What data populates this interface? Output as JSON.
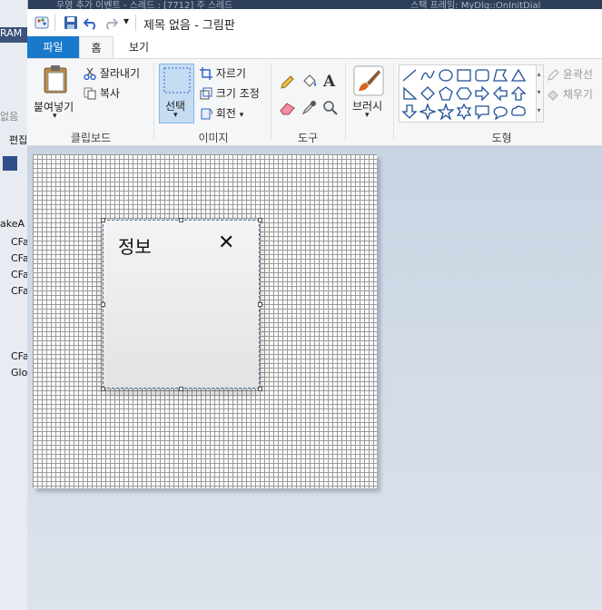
{
  "window": {
    "title": "제목 없음 - 그림판",
    "qat_dropdown": "▾"
  },
  "background": {
    "top_fragments": [
      "우영 추가 이벤트 - 스레드 : [7712] 주 스레드",
      "스택 프레임: MyDlg::OnInitDial"
    ],
    "left_fragments": [
      "RAM",
      "없음",
      "편집",
      "akeA",
      "CFa",
      "CFa",
      "CFa",
      "CFa",
      "CFa",
      "Glo"
    ]
  },
  "tabs": [
    {
      "label": "파일",
      "active": false,
      "file": true
    },
    {
      "label": "홈",
      "active": true
    },
    {
      "label": "보기",
      "active": false
    }
  ],
  "ribbon": {
    "clipboard": {
      "paste_label": "붙여넣기",
      "cut_label": "잘라내기",
      "copy_label": "복사",
      "group_label": "클립보드"
    },
    "image": {
      "select_label": "선택",
      "crop_label": "자르기",
      "resize_label": "크기 조정",
      "rotate_label": "회전",
      "group_label": "이미지"
    },
    "tools": {
      "group_label": "도구",
      "text_tool": "A"
    },
    "brushes": {
      "label": "브러시"
    },
    "shapes": {
      "group_label": "도형",
      "outline_label": "윤곽선",
      "fill_label": "채우기"
    }
  },
  "canvas_content": {
    "dialog_title": "정보",
    "close_glyph": "✕"
  },
  "colors": {
    "file_tab": "#1979ca",
    "selection": "#c5dcf3",
    "ribbon_bg": "#f5f6f7"
  }
}
